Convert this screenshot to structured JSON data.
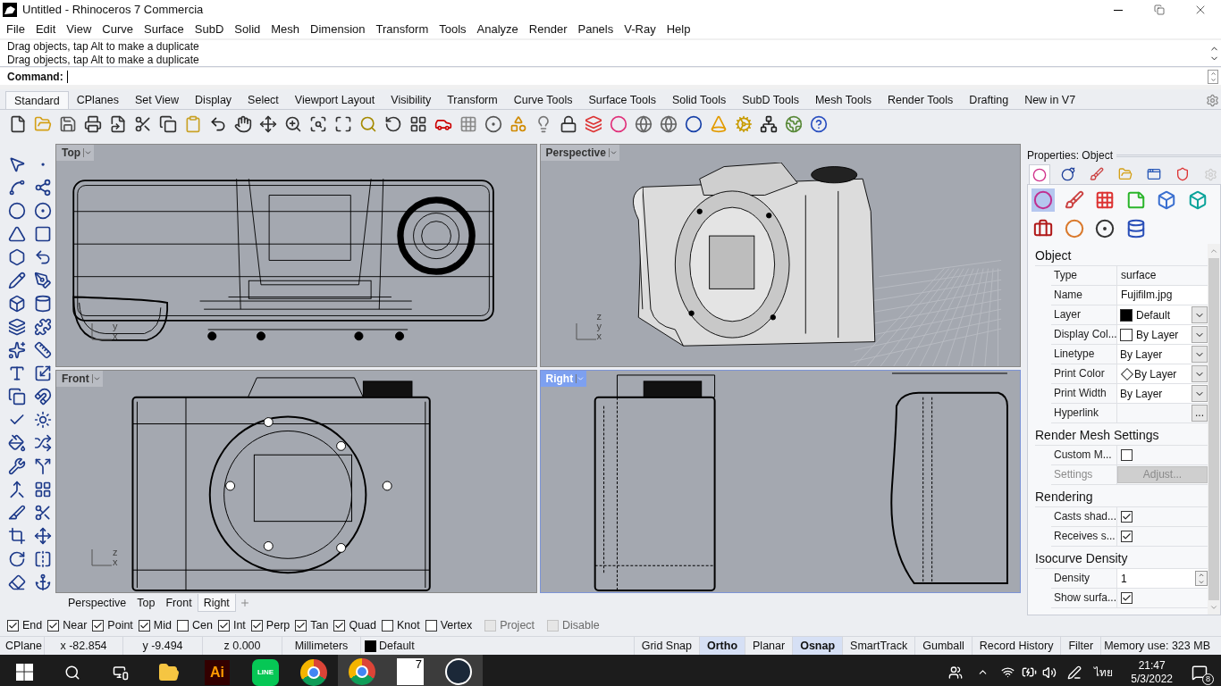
{
  "window": {
    "title": "Untitled - Rhinoceros 7 Commercia"
  },
  "menu": [
    "File",
    "Edit",
    "View",
    "Curve",
    "Surface",
    "SubD",
    "Solid",
    "Mesh",
    "Dimension",
    "Transform",
    "Tools",
    "Analyze",
    "Render",
    "Panels",
    "V-Ray",
    "Help"
  ],
  "command_history": [
    "Drag objects, tap Alt to make a duplicate",
    "Drag objects, tap Alt to make a duplicate"
  ],
  "command": {
    "prompt": "Command:"
  },
  "toolbar_tabs": [
    {
      "label": "Standard",
      "selected": true
    },
    {
      "label": "CPlanes",
      "selected": false
    },
    {
      "label": "Set View",
      "selected": false
    },
    {
      "label": "Display",
      "selected": false
    },
    {
      "label": "Select",
      "selected": false
    },
    {
      "label": "Viewport Layout",
      "selected": false
    },
    {
      "label": "Visibility",
      "selected": false
    },
    {
      "label": "Transform",
      "selected": false
    },
    {
      "label": "Curve Tools",
      "selected": false
    },
    {
      "label": "Surface Tools",
      "selected": false
    },
    {
      "label": "Solid Tools",
      "selected": false
    },
    {
      "label": "SubD Tools",
      "selected": false
    },
    {
      "label": "Mesh Tools",
      "selected": false
    },
    {
      "label": "Render Tools",
      "selected": false
    },
    {
      "label": "Drafting",
      "selected": false
    },
    {
      "label": "New in V7",
      "selected": false
    }
  ],
  "viewports": [
    {
      "title": "Top",
      "kind": "top",
      "selected": false,
      "axes": [
        "y",
        "x"
      ]
    },
    {
      "title": "Perspective",
      "kind": "perspective",
      "selected": false,
      "axes": [
        "z",
        "y",
        "x"
      ]
    },
    {
      "title": "Front",
      "kind": "front",
      "selected": false,
      "axes": [
        "z",
        "x"
      ]
    },
    {
      "title": "Right",
      "kind": "right",
      "selected": true
    }
  ],
  "viewport_tabs": [
    {
      "label": "Perspective",
      "selected": false
    },
    {
      "label": "Top",
      "selected": false
    },
    {
      "label": "Front",
      "selected": false
    },
    {
      "label": "Right",
      "selected": true
    }
  ],
  "properties": {
    "title": "Properties: Object",
    "page_tabs": [
      {
        "selected": true
      },
      {
        "selected": false
      },
      {
        "selected": false
      },
      {
        "selected": false
      },
      {
        "selected": false
      },
      {
        "selected": false
      }
    ],
    "pages": [
      {
        "selected": true
      },
      {
        "selected": false
      },
      {
        "selected": false
      },
      {
        "selected": false
      },
      {
        "selected": false
      },
      {
        "selected": false
      },
      {
        "selected": false
      },
      {
        "selected": false
      },
      {
        "selected": false
      },
      {
        "selected": false
      }
    ],
    "sections": [
      {
        "title": "Object",
        "rows": [
          {
            "kind": "text",
            "label": "Type",
            "value": "surface",
            "disabled": false
          },
          {
            "kind": "input",
            "label": "Name",
            "value": "Fujifilm.jpg",
            "disabled": false
          },
          {
            "kind": "color_dropdown",
            "label": "Layer",
            "value": "Default",
            "color": "#000000",
            "disabled": false
          },
          {
            "kind": "color_dropdown",
            "label": "Display Col...",
            "value": "By Layer",
            "color": "#ffffff",
            "disabled": false
          },
          {
            "kind": "dropdown",
            "label": "Linetype",
            "value": "By Layer",
            "disabled": false
          },
          {
            "kind": "print_color_dropdown",
            "label": "Print Color",
            "value": "By Layer",
            "disabled": false
          },
          {
            "kind": "dropdown",
            "label": "Print Width",
            "value": "By Layer",
            "disabled": false
          },
          {
            "kind": "button",
            "label": "Hyperlink",
            "value": "...",
            "disabled": false
          }
        ]
      },
      {
        "title": "Render Mesh Settings",
        "rows": [
          {
            "kind": "checkbox",
            "label": "Custom M...",
            "checked": false,
            "disabled": false
          },
          {
            "kind": "wide_button",
            "label": "Settings",
            "value": "Adjust...",
            "disabled": true
          }
        ]
      },
      {
        "title": "Rendering",
        "rows": [
          {
            "kind": "checkbox",
            "label": "Casts shad...",
            "checked": true,
            "disabled": false
          },
          {
            "kind": "checkbox",
            "label": "Receives s...",
            "checked": true,
            "disabled": false
          }
        ]
      },
      {
        "title": "Isocurve Density",
        "rows": [
          {
            "kind": "spinner",
            "label": "Density",
            "value": "1",
            "disabled": false
          },
          {
            "kind": "checkbox",
            "label": "Show surfa...",
            "checked": true,
            "disabled": false
          }
        ]
      }
    ]
  },
  "osnaps": [
    {
      "label": "End",
      "checked": true,
      "disabled": false
    },
    {
      "label": "Near",
      "checked": true,
      "disabled": false
    },
    {
      "label": "Point",
      "checked": true,
      "disabled": false
    },
    {
      "label": "Mid",
      "checked": true,
      "disabled": false
    },
    {
      "label": "Cen",
      "checked": false,
      "disabled": false
    },
    {
      "label": "Int",
      "checked": true,
      "disabled": false
    },
    {
      "label": "Perp",
      "checked": true,
      "disabled": false
    },
    {
      "label": "Tan",
      "checked": true,
      "disabled": false
    },
    {
      "label": "Quad",
      "checked": true,
      "disabled": false
    },
    {
      "label": "Knot",
      "checked": false,
      "disabled": false
    },
    {
      "label": "Vertex",
      "checked": false,
      "disabled": false
    },
    {
      "label": "Project",
      "checked": false,
      "disabled": true
    },
    {
      "label": "Disable",
      "checked": false,
      "disabled": true
    }
  ],
  "status_bar": {
    "cplane": "CPlane",
    "x": "x -82.854",
    "y": "y -9.494",
    "z": "z 0.000",
    "units": "Millimeters",
    "layer": {
      "label": "Default",
      "color": "#000000"
    },
    "toggles": [
      {
        "label": "Grid Snap",
        "on": false
      },
      {
        "label": "Ortho",
        "on": true
      },
      {
        "label": "Planar",
        "on": false
      },
      {
        "label": "Osnap",
        "on": true
      },
      {
        "label": "SmartTrack",
        "on": false
      },
      {
        "label": "Gumball",
        "on": false
      },
      {
        "label": "Record History",
        "on": false
      },
      {
        "label": "Filter",
        "on": false
      }
    ],
    "memory": "Memory use: 323 MB"
  },
  "taskbar": {
    "illustrator": "Ai",
    "line": "LINE",
    "rhino": "7",
    "language": "ไทย",
    "time": "21:47",
    "date": "5/3/2022",
    "notifications": "8"
  }
}
